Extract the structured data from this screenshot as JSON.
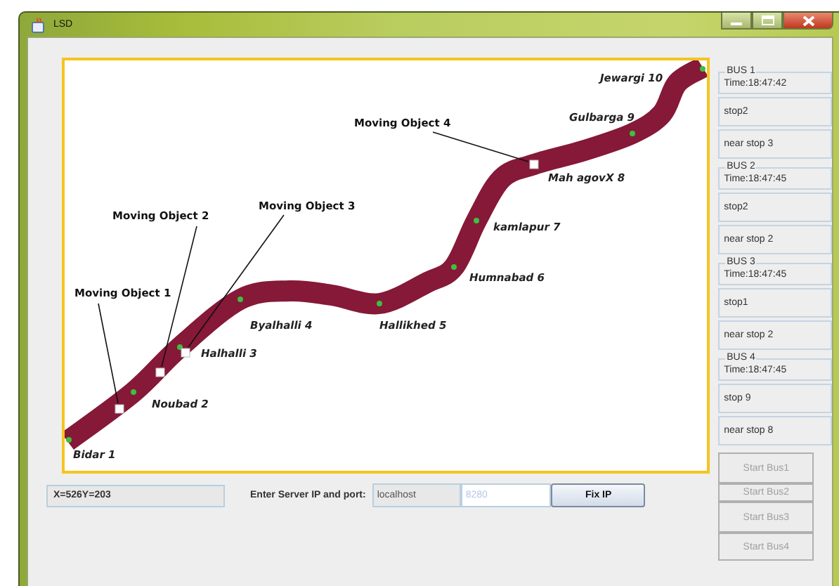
{
  "window": {
    "title": "LSD"
  },
  "map": {
    "stops": [
      {
        "name": "Jewargi 10"
      },
      {
        "name": "Gulbarga 9"
      },
      {
        "name": "Mah agovX 8"
      },
      {
        "name": "kamlapur 7"
      },
      {
        "name": "Humnabad 6"
      },
      {
        "name": "Byalhalli 4"
      },
      {
        "name": "Hallikhed 5"
      },
      {
        "name": "Halhalli 3"
      },
      {
        "name": "Noubad 2"
      },
      {
        "name": "Bidar 1"
      }
    ],
    "moving_objects": [
      {
        "label": "Moving Object 4"
      },
      {
        "label": "Moving Object 3"
      },
      {
        "label": "Moving Object 2"
      },
      {
        "label": "Moving Object 1"
      }
    ]
  },
  "buses": [
    {
      "title": "BUS 1",
      "time": "Time:18:47:42",
      "stop": "stop2",
      "status": "near stop 3"
    },
    {
      "title": "BUS 2",
      "time": "Time:18:47:45",
      "stop": "stop2",
      "status": "near stop 2"
    },
    {
      "title": "BUS 3",
      "time": "Time:18:47:45",
      "stop": "stop1",
      "status": "near stop 2"
    },
    {
      "title": "BUS 4",
      "time": "Time:18:47:45",
      "stop": "stop 9",
      "status": "near stop 8"
    }
  ],
  "coordinates": "X=526Y=203",
  "server": {
    "label": "Enter Server IP and port:",
    "ip": {
      "value": "localhost",
      "disabled": true
    },
    "port": {
      "placeholder": "8280"
    },
    "button": "Fix IP"
  },
  "start_buttons": [
    {
      "label": "Start Bus1",
      "disabled": true
    },
    {
      "label": "Start Bus2",
      "disabled": true
    },
    {
      "label": "Start Bus3",
      "disabled": true
    },
    {
      "label": "Start Bus4",
      "disabled": true
    }
  ]
}
